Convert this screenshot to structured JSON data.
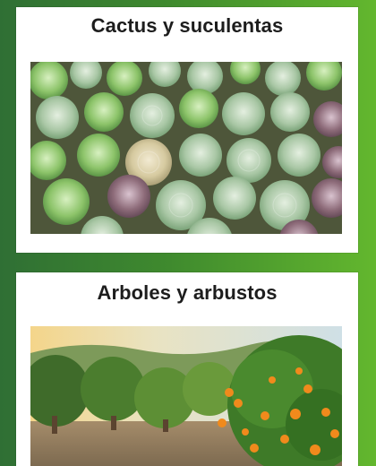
{
  "cards": [
    {
      "title": "Cactus y suculentas",
      "image_subject": "succulent plants in pots"
    },
    {
      "title": "Arboles y arbustos",
      "image_subject": "orange trees orchard"
    }
  ],
  "colors": {
    "page_gradient_start": "#2f6f34",
    "page_gradient_end": "#63b72e",
    "card_background": "#ffffff",
    "title_text": "#1d1d1d"
  }
}
